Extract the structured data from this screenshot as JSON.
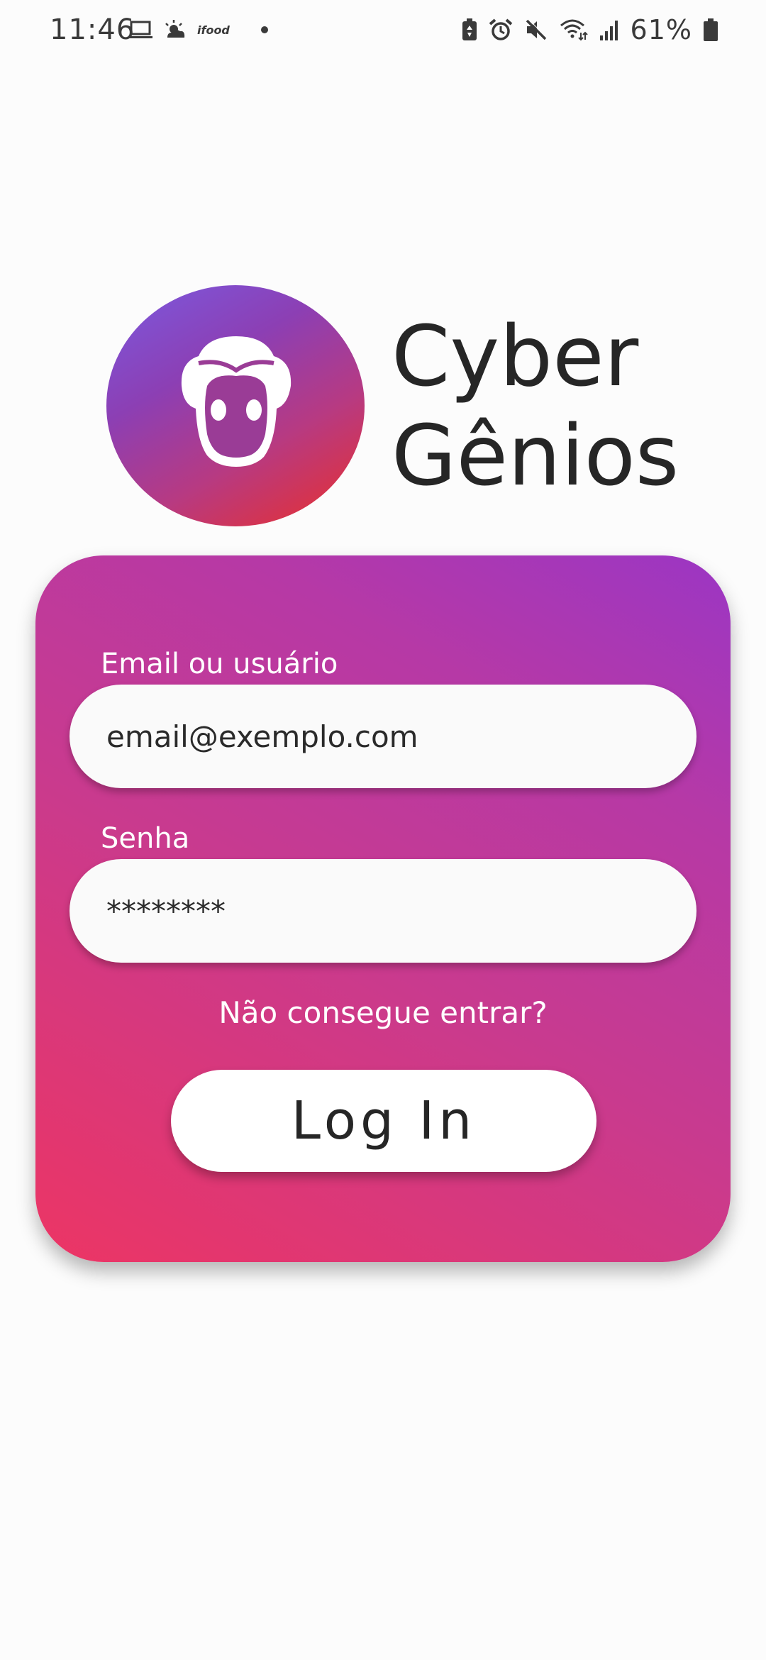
{
  "status_bar": {
    "time": "11:46",
    "left_icons": [
      "laptop-icon",
      "weather-sunrise-icon",
      "ifood-icon",
      "notification-dot-icon"
    ],
    "ifood_label": "ifood",
    "right_icons": [
      "battery-saver-icon",
      "alarm-icon",
      "mute-icon",
      "wifi-icon",
      "signal-icon",
      "battery-icon"
    ],
    "battery_percent": "61%"
  },
  "brand": {
    "line1": "Cyber",
    "line2": "Gênios",
    "logo_icon": "mascot-face-icon",
    "logo_colors": [
      "#7b5ae0",
      "#ea2f2a"
    ]
  },
  "login": {
    "email_label": "Email ou usuário",
    "email_value": "email@exemplo.com",
    "password_label": "Senha",
    "password_value": "********",
    "forgot_link": "Não consegue entrar?",
    "login_button": "Log In",
    "card_colors": [
      "#ec3564",
      "#9b36c4"
    ]
  }
}
